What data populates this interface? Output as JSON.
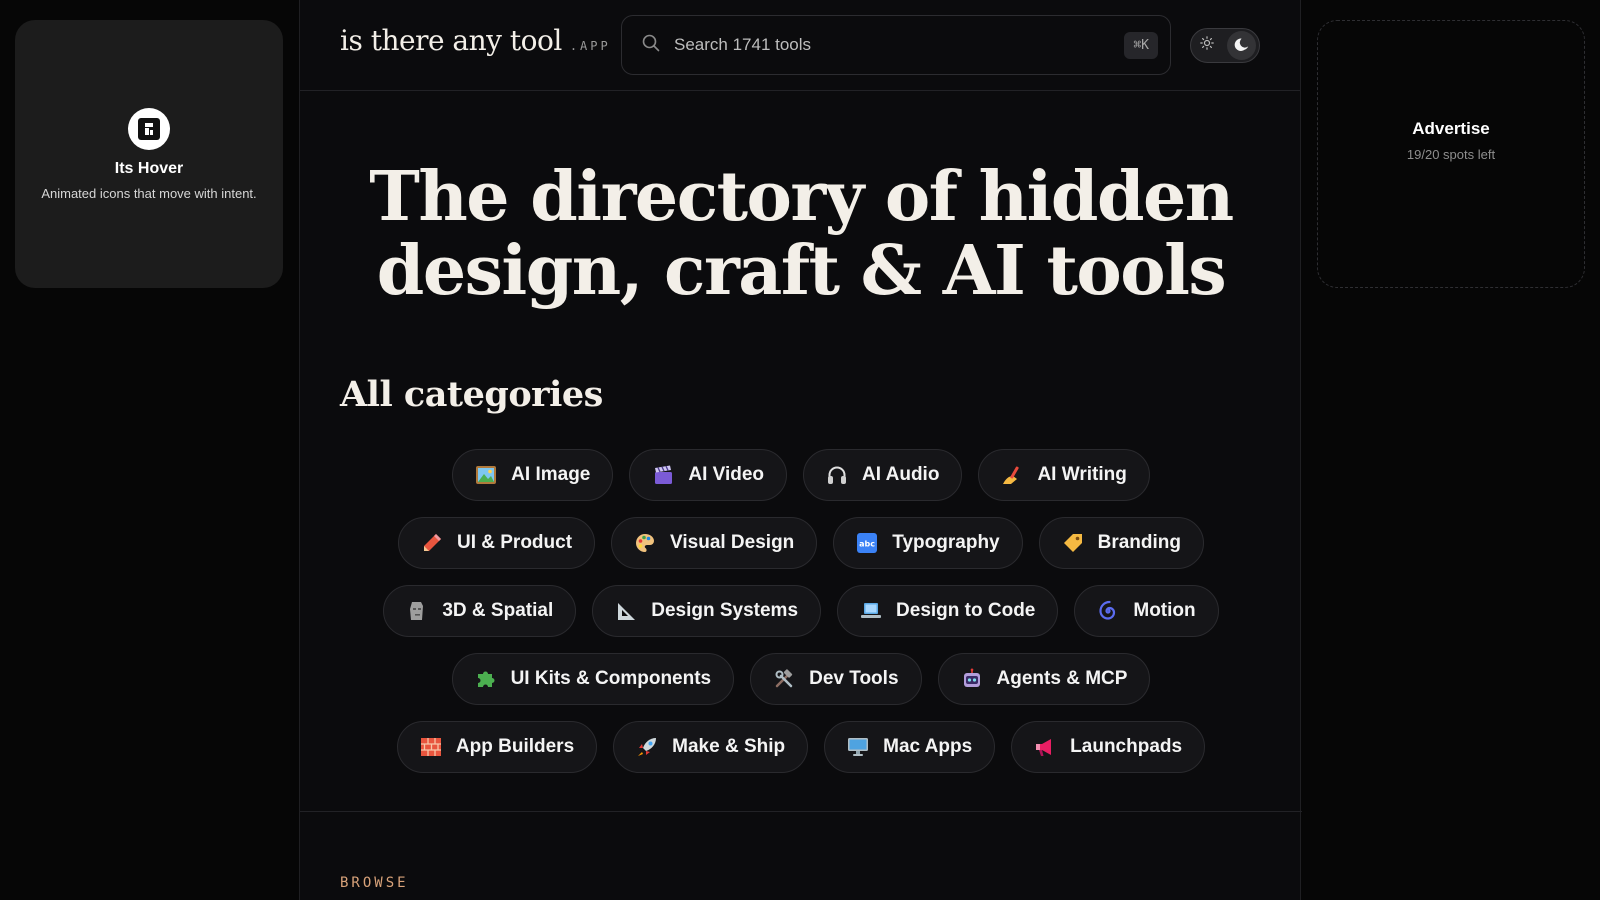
{
  "sponsor": {
    "name": "Its Hover",
    "description": "Animated icons that move with intent."
  },
  "header": {
    "brand_name": "is there any tool",
    "brand_suffix": ".APP",
    "search_placeholder": "Search 1741 tools",
    "shortcut": "⌘K"
  },
  "hero": {
    "line1": "The directory of hidden",
    "line2": "design, craft & AI tools"
  },
  "categories_section": {
    "title": "All categories",
    "rows": [
      [
        {
          "label": "AI Image",
          "icon": "framed-picture-icon"
        },
        {
          "label": "AI Video",
          "icon": "clapper-board-icon"
        },
        {
          "label": "AI Audio",
          "icon": "headphones-icon"
        },
        {
          "label": "AI Writing",
          "icon": "writing-hand-icon"
        }
      ],
      [
        {
          "label": "UI & Product",
          "icon": "pencil-icon"
        },
        {
          "label": "Visual Design",
          "icon": "artist-palette-icon"
        },
        {
          "label": "Typography",
          "icon": "abc-letters-icon"
        },
        {
          "label": "Branding",
          "icon": "label-tag-icon"
        }
      ],
      [
        {
          "label": "3D & Spatial",
          "icon": "moai-statue-icon"
        },
        {
          "label": "Design Systems",
          "icon": "triangular-ruler-icon"
        },
        {
          "label": "Design to Code",
          "icon": "laptop-icon"
        },
        {
          "label": "Motion",
          "icon": "cyclone-icon"
        }
      ],
      [
        {
          "label": "UI Kits & Components",
          "icon": "puzzle-piece-icon"
        },
        {
          "label": "Dev Tools",
          "icon": "hammer-wrench-icon"
        },
        {
          "label": "Agents & MCP",
          "icon": "robot-icon"
        }
      ],
      [
        {
          "label": "App Builders",
          "icon": "bricks-icon"
        },
        {
          "label": "Make & Ship",
          "icon": "rocket-icon"
        },
        {
          "label": "Mac Apps",
          "icon": "desktop-computer-icon"
        },
        {
          "label": "Launchpads",
          "icon": "megaphone-icon"
        }
      ]
    ]
  },
  "browse_label": "BROWSE",
  "advertise": {
    "title": "Advertise",
    "subtitle": "19/20 spots left"
  }
}
